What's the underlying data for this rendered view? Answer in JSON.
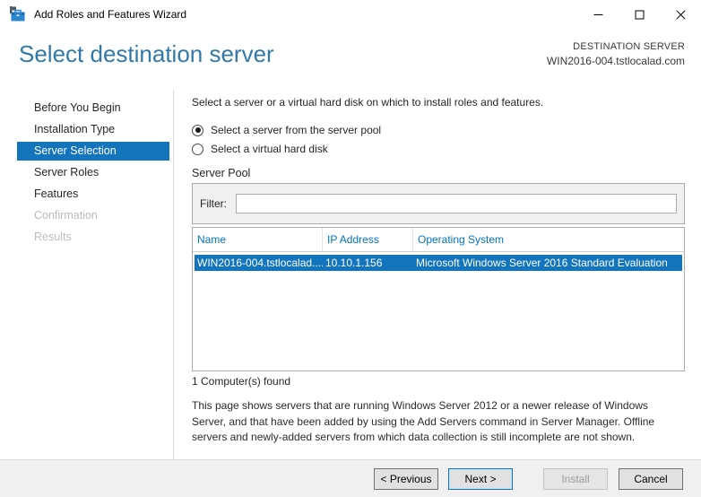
{
  "window": {
    "title": "Add Roles and Features Wizard",
    "icons": {
      "app": "wizard-toolbox-icon",
      "minimize": "minimize-icon",
      "maximize": "maximize-icon",
      "close": "close-icon"
    }
  },
  "header": {
    "title": "Select destination server",
    "destination_label": "DESTINATION SERVER",
    "destination_server": "WIN2016-004.tstlocalad.com"
  },
  "sidebar": {
    "items": [
      {
        "label": "Before You Begin",
        "state": "normal"
      },
      {
        "label": "Installation Type",
        "state": "normal"
      },
      {
        "label": "Server Selection",
        "state": "active"
      },
      {
        "label": "Server Roles",
        "state": "normal"
      },
      {
        "label": "Features",
        "state": "normal"
      },
      {
        "label": "Confirmation",
        "state": "disabled"
      },
      {
        "label": "Results",
        "state": "disabled"
      }
    ]
  },
  "main": {
    "instruction": "Select a server or a virtual hard disk on which to install roles and features.",
    "radios": [
      {
        "label": "Select a server from the server pool",
        "selected": true
      },
      {
        "label": "Select a virtual hard disk",
        "selected": false
      }
    ],
    "server_pool": {
      "label": "Server Pool",
      "filter_label": "Filter:",
      "filter_value": "",
      "table": {
        "columns": [
          "Name",
          "IP Address",
          "Operating System"
        ],
        "rows": [
          {
            "name": "WIN2016-004.tstlocalad....",
            "ip": "10.10.1.156",
            "os": "Microsoft Windows Server 2016 Standard Evaluation",
            "selected": true
          }
        ]
      },
      "found_text": "1 Computer(s) found"
    },
    "description": "This page shows servers that are running Windows Server 2012 or a newer release of Windows Server, and that have been added by using the Add Servers command in Server Manager. Offline servers and newly-added servers from which data collection is still incomplete are not shown."
  },
  "footer": {
    "buttons": [
      {
        "label": "< Previous",
        "state": "normal"
      },
      {
        "label": "Next >",
        "state": "default"
      },
      {
        "label": "Install",
        "state": "disabled"
      },
      {
        "label": "Cancel",
        "state": "normal"
      }
    ]
  },
  "colors": {
    "accent_blue": "#1474BC",
    "heading_blue": "#3079A8",
    "table_header_blue": "#0072C6",
    "default_button_border": "#0078D7",
    "footer_bg": "#f0f0f0"
  }
}
